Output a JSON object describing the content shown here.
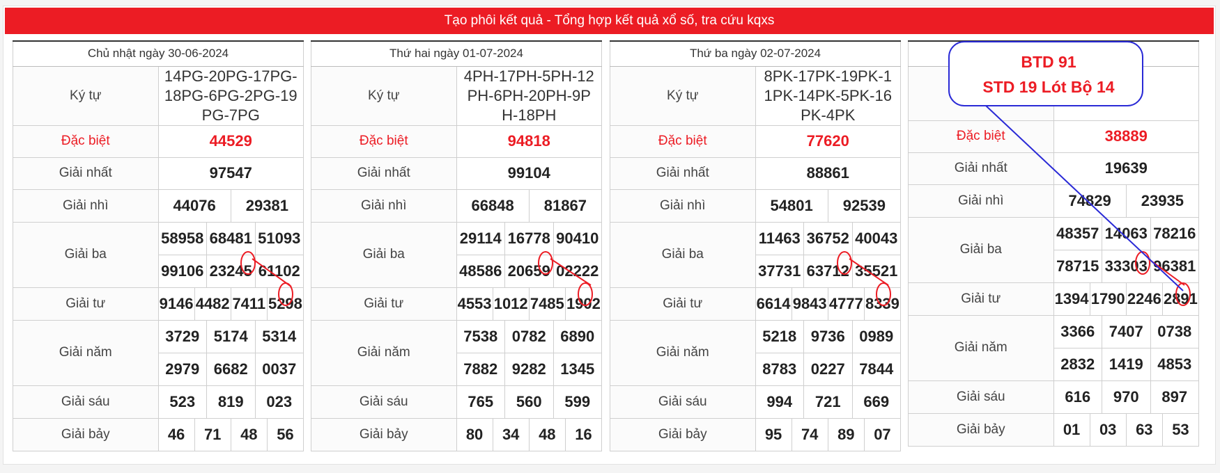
{
  "banner": "Tạo phôi kết quả - Tổng hợp kết quả xổ số, tra cứu kqxs",
  "labels": {
    "kytu": "Ký tự",
    "db": "Đặc biệt",
    "g1": "Giải nhất",
    "g2": "Giải nhì",
    "g3": "Giải ba",
    "g4": "Giải tư",
    "g5": "Giải năm",
    "g6": "Giải sáu",
    "g7": "Giải bảy"
  },
  "draws": [
    {
      "date": "Chủ nhật ngày 30-06-2024",
      "kytu": "14PG-20PG-17PG-18PG-6PG-2PG-19PG-7PG",
      "db": "44529",
      "g1": "97547",
      "g2": [
        "44076",
        "29381"
      ],
      "g3": [
        "58958",
        "68481",
        "51093",
        "99106",
        "23245",
        "61102"
      ],
      "g4": [
        "9146",
        "4482",
        "7411",
        "5298"
      ],
      "g5": [
        "3729",
        "5174",
        "5314",
        "2979",
        "6682",
        "0037"
      ],
      "g6": [
        "523",
        "819",
        "023"
      ],
      "g7": [
        "46",
        "71",
        "48",
        "56"
      ]
    },
    {
      "date": "Thứ hai ngày 01-07-2024",
      "kytu": "4PH-17PH-5PH-12PH-6PH-20PH-9PH-18PH",
      "db": "94818",
      "g1": "99104",
      "g2": [
        "66848",
        "81867"
      ],
      "g3": [
        "29114",
        "16778",
        "90410",
        "48586",
        "20659",
        "02222"
      ],
      "g4": [
        "4553",
        "1012",
        "7485",
        "1902"
      ],
      "g5": [
        "7538",
        "0782",
        "6890",
        "7882",
        "9282",
        "1345"
      ],
      "g6": [
        "765",
        "560",
        "599"
      ],
      "g7": [
        "80",
        "34",
        "48",
        "16"
      ]
    },
    {
      "date": "Thứ ba ngày 02-07-2024",
      "kytu": "8PK-17PK-19PK-11PK-14PK-5PK-16PK-4PK",
      "db": "77620",
      "g1": "88861",
      "g2": [
        "54801",
        "92539"
      ],
      "g3": [
        "11463",
        "36752",
        "40043",
        "37731",
        "63712",
        "35521"
      ],
      "g4": [
        "6614",
        "9843",
        "4777",
        "8339"
      ],
      "g5": [
        "5218",
        "9736",
        "0989",
        "8783",
        "0227",
        "7844"
      ],
      "g6": [
        "994",
        "721",
        "669"
      ],
      "g7": [
        "95",
        "74",
        "89",
        "07"
      ]
    },
    {
      "date": "",
      "kytu": "",
      "db": "38889",
      "g1": "19639",
      "g2": [
        "74829",
        "23935"
      ],
      "g3": [
        "48357",
        "14063",
        "78216",
        "78715",
        "33303",
        "96381"
      ],
      "g4": [
        "1394",
        "1790",
        "2246",
        "2891"
      ],
      "g5": [
        "3366",
        "7407",
        "0738",
        "2832",
        "1419",
        "4853"
      ],
      "g6": [
        "616",
        "970",
        "897"
      ],
      "g7": [
        "01",
        "03",
        "63",
        "53"
      ]
    }
  ],
  "note": {
    "line1": "BTD 91",
    "line2": "STD 19 Lót Bộ 14"
  },
  "colors": {
    "accent": "#ec1c24",
    "annotation_line": "#2a2ad6"
  }
}
